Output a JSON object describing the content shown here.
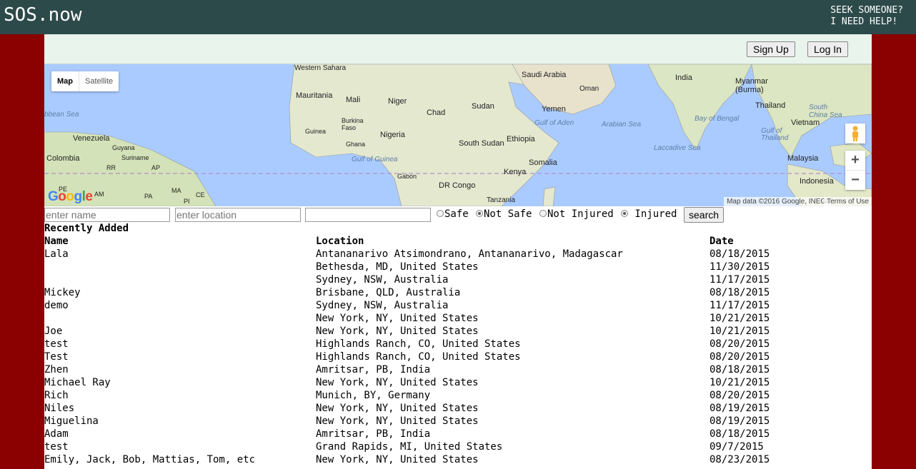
{
  "header": {
    "brand": "SOS.now",
    "tagline_line1": "SEEK SOMEONE?",
    "tagline_line2": "I NEED HELP!"
  },
  "auth": {
    "signup_label": "Sign Up",
    "login_label": "Log In"
  },
  "map": {
    "type_map": "Map",
    "type_satellite": "Satellite",
    "attribution": "Map data ©2016 Google, INEGI",
    "terms": "Terms of Use",
    "logo": "Google",
    "zoom_in": "+",
    "zoom_out": "−",
    "labels": {
      "western_sahara": "Western Sahara",
      "mauritania": "Mauritania",
      "mali": "Mali",
      "niger": "Niger",
      "chad": "Chad",
      "sudan": "Sudan",
      "saudi_arabia": "Saudi Arabia",
      "oman": "Oman",
      "yemen": "Yemen",
      "india": "India",
      "myanmar": "Myanmar (Burma)",
      "thailand": "Thailand",
      "south_china_sea": "South China Sea",
      "vietnam": "Vietnam",
      "bay_of_bengal": "Bay of Bengal",
      "arabian_sea": "Arabian Sea",
      "gulf_of_aden": "Gulf of Aden",
      "ethiopia": "Ethiopia",
      "south_sudan": "South Sudan",
      "nigeria": "Nigeria",
      "burkina_faso": "Burkina Faso",
      "guinea": "Guinea",
      "ghana": "Ghana",
      "gulf_of_guinea": "Gulf of Guinea",
      "somalia": "Somalia",
      "kenya": "Kenya",
      "gabon": "Gabon",
      "dr_congo": "DR Congo",
      "tanzania": "Tanzania",
      "laccadive_sea": "Laccadive Sea",
      "gulf_of_thailand": "Gulf of Thailand",
      "malaysia": "Malaysia",
      "indonesia": "Indonesia",
      "caribbean_sea": "bbean Sea",
      "venezuela": "Venezuela",
      "guyana": "Guyana",
      "suriname": "Suriname",
      "colombia": "Colombia",
      "pe": "PE",
      "am": "AM",
      "pa": "PA",
      "ma": "MA",
      "ce": "CE",
      "pi": "PI",
      "rr": "RR",
      "ap": "AP"
    }
  },
  "search": {
    "name_placeholder": "enter name",
    "location_placeholder": "enter location",
    "extra_placeholder": "",
    "opt_safe": "Safe",
    "opt_not_safe": "Not Safe",
    "opt_not_injured": "Not Injured",
    "opt_injured": " Injured",
    "search_label": "search"
  },
  "recent": {
    "title": "Recently Added",
    "columns": [
      "Name",
      "Location",
      "Date"
    ],
    "rows": [
      {
        "name": "Lala",
        "location": "Antananarivo Atsimondrano, Antananarivo, Madagascar",
        "date": "08/18/2015"
      },
      {
        "name": "",
        "location": "Bethesda, MD, United States",
        "date": "11/30/2015"
      },
      {
        "name": "",
        "location": "Sydney, NSW, Australia",
        "date": "11/17/2015"
      },
      {
        "name": "Mickey",
        "location": "Brisbane, QLD, Australia",
        "date": "08/18/2015"
      },
      {
        "name": "demo",
        "location": "Sydney, NSW, Australia",
        "date": "11/17/2015"
      },
      {
        "name": "",
        "location": "New York, NY, United States",
        "date": "10/21/2015"
      },
      {
        "name": "Joe",
        "location": "New York, NY, United States",
        "date": "10/21/2015"
      },
      {
        "name": "test",
        "location": "Highlands Ranch, CO, United States",
        "date": "08/20/2015"
      },
      {
        "name": "Test",
        "location": "Highlands Ranch, CO, United States",
        "date": "08/20/2015"
      },
      {
        "name": "Zhen",
        "location": "Amritsar, PB, India",
        "date": "08/18/2015"
      },
      {
        "name": "Michael Ray",
        "location": "New York, NY, United States",
        "date": "10/21/2015"
      },
      {
        "name": "Rich",
        "location": "Munich, BY, Germany",
        "date": "08/20/2015"
      },
      {
        "name": "Niles",
        "location": "New York, NY, United States",
        "date": "08/19/2015"
      },
      {
        "name": "Miguelina",
        "location": "New York, NY, United States",
        "date": "08/19/2015"
      },
      {
        "name": "Adam",
        "location": "Amritsar, PB, India",
        "date": "08/18/2015"
      },
      {
        "name": "test",
        "location": "Grand Rapids, MI, United States",
        "date": "09/7/2015"
      },
      {
        "name": "Emily, Jack, Bob, Mattias, Tom, etc",
        "location": "New York, NY, United States",
        "date": "08/23/2015"
      }
    ]
  }
}
